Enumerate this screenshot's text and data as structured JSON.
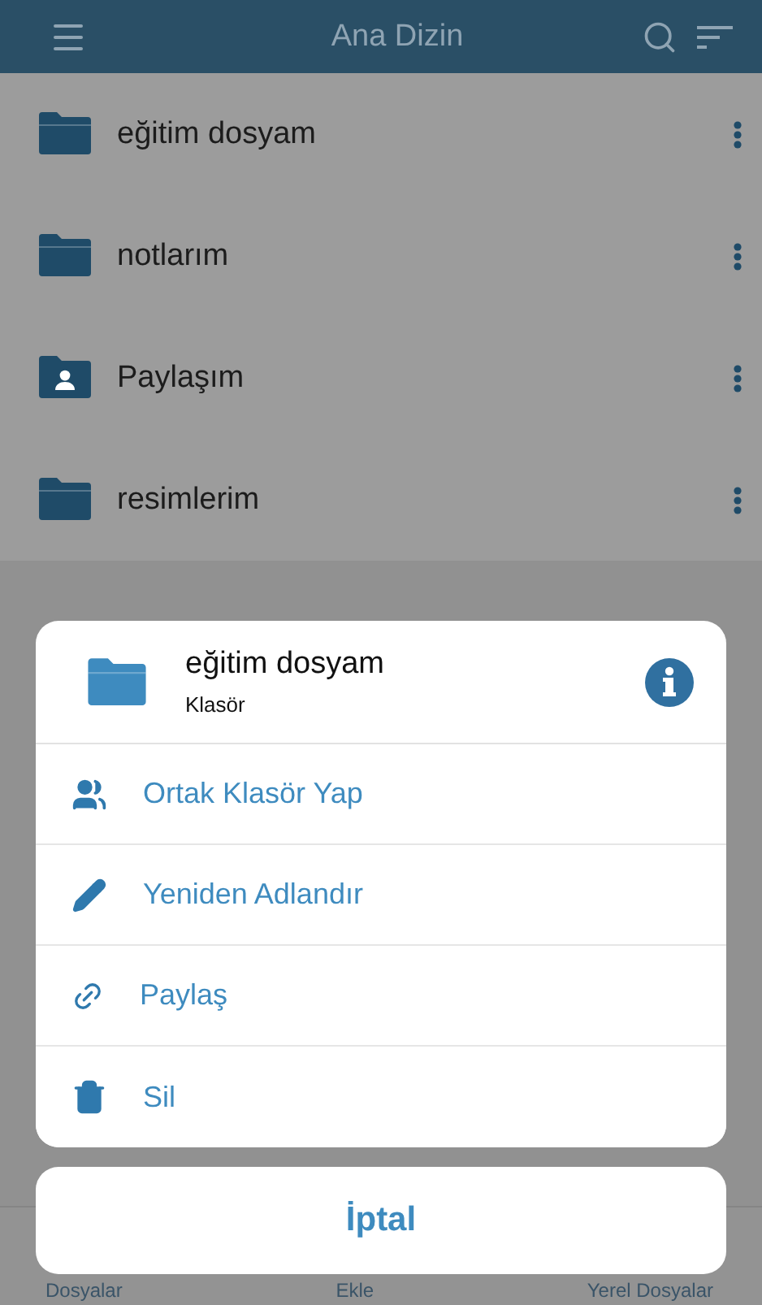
{
  "header": {
    "title": "Ana Dizin"
  },
  "items": [
    {
      "name": "eğitim dosyam",
      "kind": "folder"
    },
    {
      "name": "notlarım",
      "kind": "folder"
    },
    {
      "name": "Paylaşım",
      "kind": "shared"
    },
    {
      "name": "resimlerim",
      "kind": "folder"
    }
  ],
  "tab_bar": {
    "tabs": [
      "Dosyalar",
      "Ekle",
      "Yerel Dosyalar"
    ]
  },
  "action_sheet": {
    "title": "eğitim dosyam",
    "subtitle": "Klasör",
    "actions": [
      {
        "label": "Ortak Klasör Yap",
        "kind": "people"
      },
      {
        "label": "Yeniden Adlandır",
        "kind": "pencil"
      },
      {
        "label": "Paylaş",
        "kind": "link"
      },
      {
        "label": "Sil",
        "kind": "trash"
      }
    ],
    "cancel": "İptal"
  }
}
